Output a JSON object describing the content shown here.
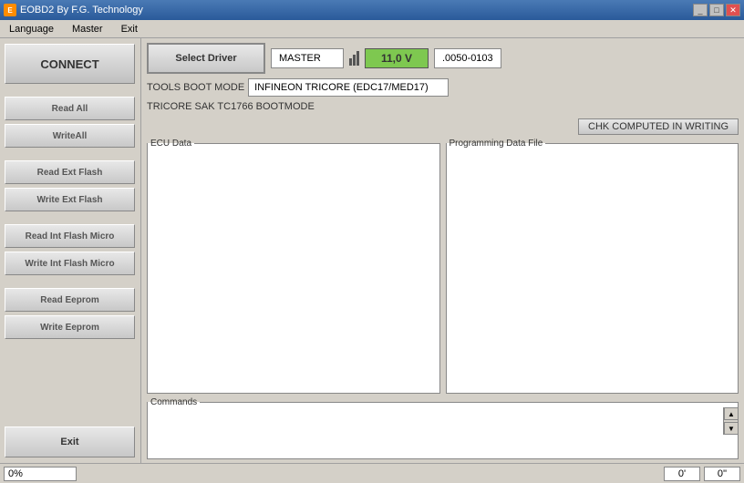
{
  "titleBar": {
    "title": "EOBD2 By F.G. Technology",
    "icon": "E",
    "controls": {
      "minimize": "_",
      "maximize": "□",
      "close": "✕"
    }
  },
  "menuBar": {
    "items": [
      "Language",
      "Master",
      "Exit"
    ]
  },
  "sidebar": {
    "connectBtn": "CONNECT",
    "buttons": [
      {
        "label": "Read All",
        "id": "read-all"
      },
      {
        "label": "WriteAll",
        "id": "write-all"
      },
      {
        "label": "Read Ext Flash",
        "id": "read-ext-flash"
      },
      {
        "label": "Write Ext Flash",
        "id": "write-ext-flash"
      },
      {
        "label": "Read Int Flash Micro",
        "id": "read-int-flash-micro"
      },
      {
        "label": "Write Int Flash Micro",
        "id": "write-int-flash-micro"
      },
      {
        "label": "Read Eeprom",
        "id": "read-eeprom"
      },
      {
        "label": "Write Eeprom",
        "id": "write-eeprom"
      }
    ],
    "exitBtn": "Exit"
  },
  "header": {
    "selectDriver": "Select Driver",
    "master": "MASTER",
    "voltage": "11,0 V",
    "version": ".0050-0103"
  },
  "info": {
    "toolsBootModeLabel": "TOOLS BOOT MODE",
    "toolsBootModeValue": "INFINEON TRICORE (EDC17/MED17)",
    "tricoreSak": "TRICORE SAK TC1766  BOOTMODE"
  },
  "chkBtn": "CHK COMPUTED IN WRITING",
  "panels": {
    "ecuData": "ECU Data",
    "programmingDataFile": "Programming Data File"
  },
  "commands": {
    "label": "Commands"
  },
  "statusBar": {
    "progress": "0%",
    "coord1": "0'",
    "coord2": "0''"
  }
}
